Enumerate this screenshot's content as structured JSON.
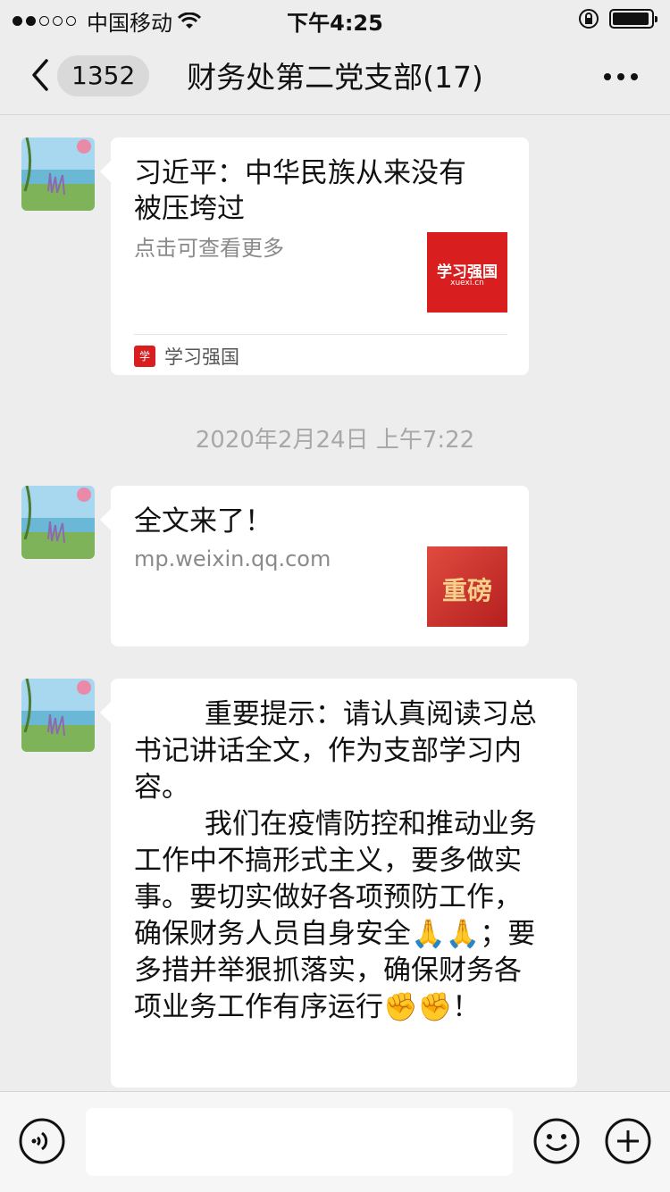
{
  "status_bar": {
    "carrier": "中国移动",
    "time": "下午4:25"
  },
  "nav": {
    "unread_count": "1352",
    "title": "财务处第二党支部(17)"
  },
  "messages": [
    {
      "type": "link",
      "title": "习近平：中华民族从来没有被压垮过",
      "desc": "点击可查看更多",
      "thumb_text": "学习强国",
      "thumb_sub": "xuexi.cn",
      "source": "学习强国"
    },
    {
      "type": "link",
      "title": "全文来了！",
      "desc": "mp.weixin.qq.com",
      "thumb_text": "重磅"
    },
    {
      "type": "text",
      "text": "        重要提示：请认真阅读习总书记讲话全文，作为支部学习内容。\n        我们在疫情防控和推动业务工作中不搞形式主义，要多做实事。要切实做好各项预防工作，确保财务人员自身安全🙏🙏；要多措并举狠抓落实，确保财务各项业务工作有序运行✊✊！"
    }
  ],
  "timestamp": "2020年2月24日 上午7:22",
  "colors": {
    "background": "#ededed",
    "bubble": "#ffffff",
    "brand_red": "#d81e1e"
  }
}
